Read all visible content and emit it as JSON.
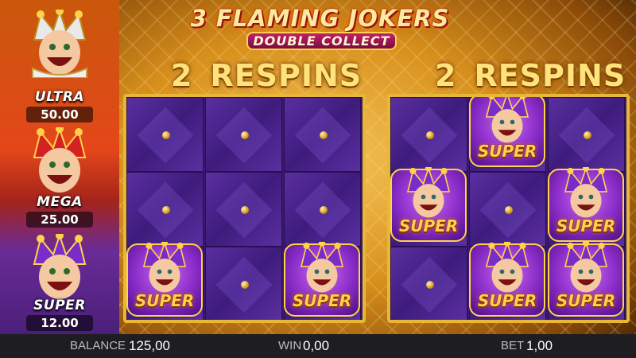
{
  "logo": {
    "line1": "3 FLAMING JOKERS",
    "line2": "DOUBLE COLLECT"
  },
  "jackpots": [
    {
      "tier": "ULTRA",
      "amount": "50.00"
    },
    {
      "tier": "MEGA",
      "amount": "25.00"
    },
    {
      "tier": "SUPER",
      "amount": "12.00"
    }
  ],
  "reels": [
    {
      "respins_count": "2",
      "respins_label": "RESPINS",
      "symbols": [
        {
          "label": "SUPER",
          "row": 3,
          "col": 1
        },
        {
          "label": "SUPER",
          "row": 3,
          "col": 3
        }
      ]
    },
    {
      "respins_count": "2",
      "respins_label": "RESPINS",
      "symbols": [
        {
          "label": "SUPER",
          "row": 1,
          "col": 2
        },
        {
          "label": "SUPER",
          "row": 2,
          "col": 1
        },
        {
          "label": "SUPER",
          "row": 2,
          "col": 3
        },
        {
          "label": "SUPER",
          "row": 3,
          "col": 2
        },
        {
          "label": "SUPER",
          "row": 3,
          "col": 3
        }
      ]
    }
  ],
  "status_bar": {
    "balance_label": "BALANCE",
    "balance_value": "125,00",
    "win_label": "WIN",
    "win_value": "0,00",
    "bet_label": "BET",
    "bet_value": "1,00"
  },
  "colors": {
    "gold": "#e8b738",
    "purple": "#3a1a6a",
    "accent": "#ffd24a"
  }
}
